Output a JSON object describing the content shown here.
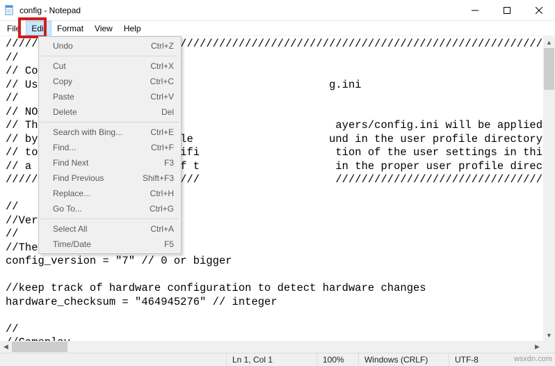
{
  "window": {
    "title": "config - Notepad"
  },
  "menubar": {
    "items": [
      "File",
      "Edit",
      "Format",
      "View",
      "Help"
    ]
  },
  "edit_menu": {
    "items": [
      {
        "label": "Undo",
        "shortcut": "Ctrl+Z"
      },
      null,
      {
        "label": "Cut",
        "shortcut": "Ctrl+X"
      },
      {
        "label": "Copy",
        "shortcut": "Ctrl+C"
      },
      {
        "label": "Paste",
        "shortcut": "Ctrl+V"
      },
      {
        "label": "Delete",
        "shortcut": "Del"
      },
      null,
      {
        "label": "Search with Bing...",
        "shortcut": "Ctrl+E"
      },
      {
        "label": "Find...",
        "shortcut": "Ctrl+F"
      },
      {
        "label": "Find Next",
        "shortcut": "F3"
      },
      {
        "label": "Find Previous",
        "shortcut": "Shift+F3"
      },
      {
        "label": "Replace...",
        "shortcut": "Ctrl+H"
      },
      {
        "label": "Go To...",
        "shortcut": "Ctrl+G"
      },
      null,
      {
        "label": "Select All",
        "shortcut": "Ctrl+A"
      },
      {
        "label": "Time/Date",
        "shortcut": "F5"
      }
    ]
  },
  "content": {
    "lines": [
      "//////////////////////////////////////////////////////////////////////////////////////////////////",
      "//",
      "// Config file.",
      "// Users config directory:                        g.ini",
      "//",
      "// NOTE:",
      "// The data in                                     ayers/config.ini will be applied on boot and will be overridden.",
      "// by the default config file                     und in the user profile directory once the user is logged in",
      "// to the computer. Any modifi                     tion of the user settings in this file should be followed by",
      "// a similar modification of t                     in the proper user profile directory.",
      "//////////////////////////////                     ///////////////////////////////////////////////////////////////",
      "",
      "//",
      "//Version",
      "//",
      "//The version of the config",
      "config_version = \"7\" // 0 or bigger",
      "",
      "//keep track of hardware configuration to detect hardware changes",
      "hardware_checksum = \"464945276\" // integer",
      "",
      "//",
      "//Gameplay"
    ]
  },
  "status": {
    "position": "Ln 1, Col 1",
    "zoom": "100%",
    "line_ending": "Windows (CRLF)",
    "encoding": "UTF-8",
    "watermark": "wsxdn.com"
  }
}
